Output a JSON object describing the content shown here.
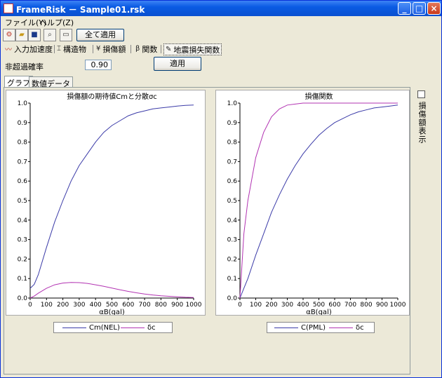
{
  "window": {
    "title": "FrameRisk － Sample01.rsk",
    "controls": [
      "_",
      "□",
      "×"
    ]
  },
  "menu": [
    {
      "label": "ファイル(Y)"
    },
    {
      "label": "ヘルプ(Z)"
    }
  ],
  "toolbar": {
    "apply_all_label": "全て適用"
  },
  "tabs": [
    {
      "label": "入力加速度",
      "icon": "wave-icon",
      "glyph": "〰"
    },
    {
      "label": "構造物",
      "icon": "building-icon",
      "glyph": "⌶"
    },
    {
      "label": "損傷額",
      "icon": "yen-icon",
      "glyph": "¥"
    },
    {
      "label": "関数",
      "icon": "beta-icon",
      "glyph": "β"
    },
    {
      "label": "地震損失関数",
      "icon": "pencil-icon",
      "glyph": "✎"
    }
  ],
  "exceedance": {
    "label": "非超過確率",
    "value": "0.90",
    "apply_label": "適用"
  },
  "subtabs": [
    {
      "label": "グラフ"
    },
    {
      "label": "数値データ"
    }
  ],
  "side": {
    "checkbox_label": "損傷額表示",
    "checked": false
  },
  "colors": {
    "blue": "#3b3ba8",
    "magenta": "#b233b2"
  },
  "chart_data": [
    {
      "type": "line",
      "title": "損傷額の期待値Cmと分散σc",
      "xlabel": "αB(gal)",
      "ylabel": "",
      "xlim": [
        0,
        1000
      ],
      "ylim": [
        0,
        1.0
      ],
      "x_ticks": [
        "0",
        "100",
        "200",
        "300",
        "400",
        "500",
        "600",
        "700",
        "800",
        "900",
        "1000"
      ],
      "y_ticks": [
        "0.0",
        "0.1",
        "0.2",
        "0.3",
        "0.4",
        "0.5",
        "0.6",
        "0.7",
        "0.8",
        "0.9",
        "1.0"
      ],
      "x": [
        0,
        25,
        50,
        100,
        150,
        200,
        250,
        300,
        350,
        400,
        450,
        500,
        550,
        600,
        650,
        700,
        750,
        800,
        850,
        900,
        950,
        1000
      ],
      "series": [
        {
          "name": "Cm(NEL)",
          "color": "#3b3ba8",
          "values": [
            0.05,
            0.07,
            0.12,
            0.26,
            0.39,
            0.5,
            0.6,
            0.68,
            0.74,
            0.8,
            0.85,
            0.885,
            0.91,
            0.935,
            0.95,
            0.96,
            0.97,
            0.975,
            0.98,
            0.985,
            0.988,
            0.99
          ]
        },
        {
          "name": "δc",
          "color": "#b233b2",
          "values": [
            0.0,
            0.01,
            0.025,
            0.05,
            0.068,
            0.077,
            0.08,
            0.079,
            0.075,
            0.068,
            0.06,
            0.051,
            0.042,
            0.034,
            0.027,
            0.021,
            0.016,
            0.012,
            0.009,
            0.006,
            0.004,
            0.003
          ]
        }
      ]
    },
    {
      "type": "line",
      "title": "損傷関数",
      "xlabel": "αB(gal)",
      "ylabel": "",
      "xlim": [
        0,
        1000
      ],
      "ylim": [
        0,
        1.0
      ],
      "x_ticks": [
        "0",
        "100",
        "200",
        "300",
        "400",
        "500",
        "600",
        "700",
        "800",
        "900",
        "1000"
      ],
      "y_ticks": [
        "0.0",
        "0.1",
        "0.2",
        "0.3",
        "0.4",
        "0.5",
        "0.6",
        "0.7",
        "0.8",
        "0.9",
        "1.0"
      ],
      "x": [
        0,
        25,
        50,
        100,
        150,
        200,
        250,
        300,
        350,
        400,
        450,
        500,
        550,
        600,
        650,
        700,
        750,
        800,
        850,
        900,
        950,
        1000
      ],
      "series": [
        {
          "name": "C(PML)",
          "color": "#3b3ba8",
          "values": [
            0.0,
            0.05,
            0.1,
            0.22,
            0.33,
            0.44,
            0.53,
            0.61,
            0.68,
            0.74,
            0.79,
            0.835,
            0.87,
            0.9,
            0.92,
            0.94,
            0.955,
            0.965,
            0.975,
            0.98,
            0.985,
            0.99
          ]
        },
        {
          "name": "δc",
          "color": "#b233b2",
          "values": [
            0.0,
            0.33,
            0.5,
            0.72,
            0.85,
            0.93,
            0.97,
            0.99,
            0.995,
            1.0,
            1.0,
            1.0,
            1.0,
            1.0,
            1.0,
            1.0,
            1.0,
            1.0,
            1.0,
            1.0,
            1.0,
            1.0
          ]
        }
      ]
    }
  ]
}
